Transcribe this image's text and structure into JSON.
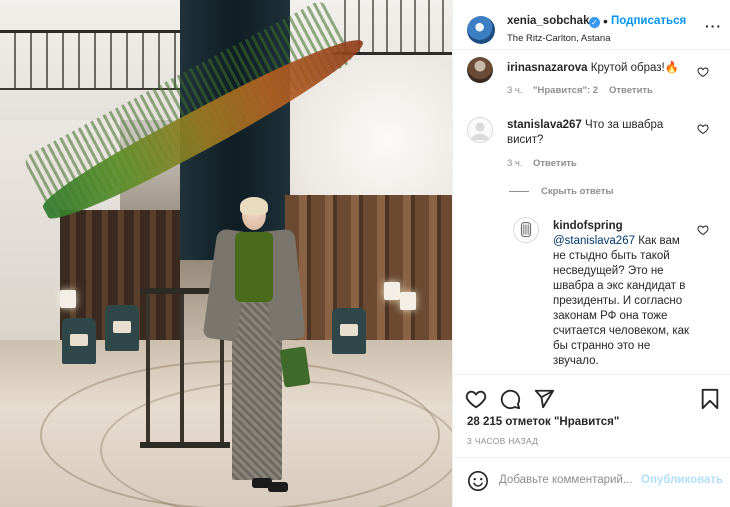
{
  "post": {
    "username": "xenia_sobchak",
    "follow_label": "Подписаться",
    "location": "The Ritz-Carlton, Astana",
    "more_icon": "ellipsis-icon"
  },
  "comments": [
    {
      "username": "irinasnazarova",
      "text": "Крутой образ!🔥",
      "time": "3 ч.",
      "likes": "\"Нравится\": 2",
      "reply_label": "Ответить"
    },
    {
      "username": "stanislava267",
      "text": "Что за швабра висит?",
      "time": "3 ч.",
      "reply_label": "Ответить",
      "hide_replies": "Скрыть ответы",
      "reply": {
        "username": "kindofspring",
        "mention": "@stanislava267",
        "text": " Как вам не стыдно быть такой несведущей? Это не швабра а экс кандидат в президенты. И согласно законам РФ она тоже считается человеком, как бы странно это не звучало."
      }
    }
  ],
  "actions": {
    "like_icon": "heart-icon",
    "comment_icon": "comment-icon",
    "share_icon": "share-icon",
    "save_icon": "bookmark-icon"
  },
  "likes_count": "28 215 отметок \"Нравится\"",
  "time_ago": "3 часов назад",
  "add_comment": {
    "placeholder": "Добавьте комментарий...",
    "publish_label": "Опубликовать"
  },
  "colors": {
    "link_blue": "#0095f6",
    "publish_disabled": "#b2dffc",
    "secondary_text": "#8e8e8e",
    "verified": "#3897f0"
  }
}
